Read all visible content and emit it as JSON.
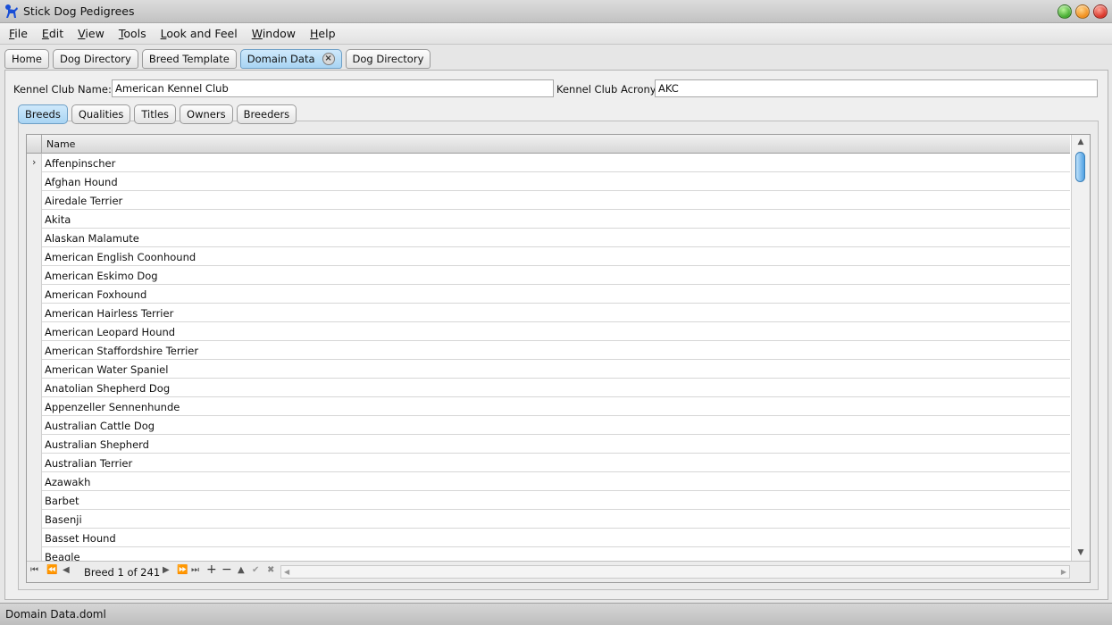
{
  "window": {
    "title": "Stick Dog Pedigrees"
  },
  "menu": [
    "File",
    "Edit",
    "View",
    "Tools",
    "Look and Feel",
    "Window",
    "Help"
  ],
  "doc_tabs": [
    {
      "label": "Home"
    },
    {
      "label": "Dog Directory"
    },
    {
      "label": "Breed Template"
    },
    {
      "label": "Domain Data",
      "active": true
    },
    {
      "label": "Dog Directory"
    }
  ],
  "form": {
    "kennel_name_label": "Kennel Club Name:",
    "kennel_name_value": "American Kennel Club",
    "acronym_label": "Kennel Club Acronym:",
    "acronym_value": "AKC"
  },
  "sub_tabs": [
    {
      "label": "Breeds",
      "active": true
    },
    {
      "label": "Qualities"
    },
    {
      "label": "Titles"
    },
    {
      "label": "Owners"
    },
    {
      "label": "Breeders"
    }
  ],
  "grid": {
    "column": "Name",
    "rows": [
      "Affenpinscher",
      "Afghan Hound",
      "Airedale Terrier",
      "Akita",
      "Alaskan Malamute",
      "American English Coonhound",
      "American Eskimo Dog",
      "American Foxhound",
      "American Hairless Terrier",
      "American Leopard Hound",
      "American Staffordshire Terrier",
      "American Water Spaniel",
      "Anatolian Shepherd Dog",
      "Appenzeller Sennenhunde",
      "Australian Cattle Dog",
      "Australian Shepherd",
      "Australian Terrier",
      "Azawakh",
      "Barbet",
      "Basenji",
      "Basset Hound",
      "Beagle"
    ]
  },
  "navigator": {
    "text": "Breed 1 of 241"
  },
  "status": {
    "text": "Domain Data.doml"
  },
  "colors": {
    "active_tab": "#a8d4f3",
    "scroll_thumb": "#4fa0e2"
  }
}
